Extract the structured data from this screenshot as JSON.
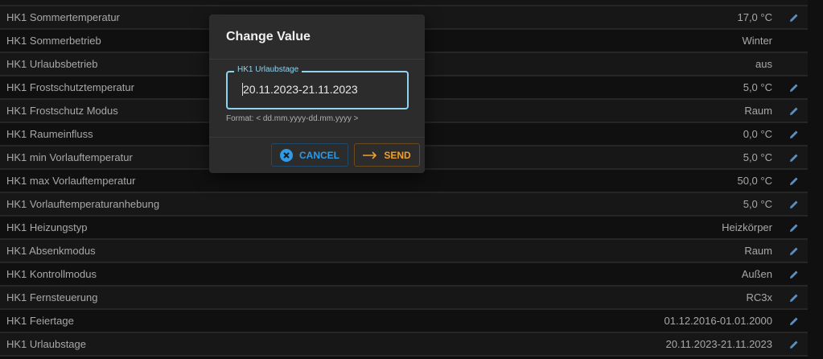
{
  "rows": [
    {
      "label": "HK1 Sommertemperatur",
      "value": "17,0 °C",
      "editable": true
    },
    {
      "label": "HK1 Sommerbetrieb",
      "value": "Winter",
      "editable": false
    },
    {
      "label": "HK1 Urlaubsbetrieb",
      "value": "aus",
      "editable": false
    },
    {
      "label": "HK1 Frostschutztemperatur",
      "value": "5,0 °C",
      "editable": true
    },
    {
      "label": "HK1 Frostschutz Modus",
      "value": "Raum",
      "editable": true
    },
    {
      "label": "HK1 Raumeinfluss",
      "value": "0,0 °C",
      "editable": true
    },
    {
      "label": "HK1 min Vorlauftemperatur",
      "value": "5,0 °C",
      "editable": true
    },
    {
      "label": "HK1 max Vorlauftemperatur",
      "value": "50,0 °C",
      "editable": true
    },
    {
      "label": "HK1 Vorlauftemperaturanhebung",
      "value": "5,0 °C",
      "editable": true
    },
    {
      "label": "HK1 Heizungstyp",
      "value": "Heizkörper",
      "editable": true
    },
    {
      "label": "HK1 Absenkmodus",
      "value": "Raum",
      "editable": true
    },
    {
      "label": "HK1 Kontrollmodus",
      "value": "Außen",
      "editable": true
    },
    {
      "label": "HK1 Fernsteuerung",
      "value": "RC3x",
      "editable": true
    },
    {
      "label": "HK1 Feiertage",
      "value": "01.12.2016-01.01.2000",
      "editable": true
    },
    {
      "label": "HK1 Urlaubstage",
      "value": "20.11.2023-21.11.2023",
      "editable": true
    }
  ],
  "dialog": {
    "title": "Change Value",
    "field_label": "HK1 Urlaubstage",
    "field_value": "20.11.2023-21.11.2023",
    "hint": "Format: < dd.mm.yyyy-dd.mm.yyyy >",
    "cancel_label": "CANCEL",
    "send_label": "SEND"
  },
  "colors": {
    "accent": "#8fd3f0",
    "cancel": "#2f9ae6",
    "send": "#f0a02a",
    "edit_icon": "#5b8fc0"
  }
}
